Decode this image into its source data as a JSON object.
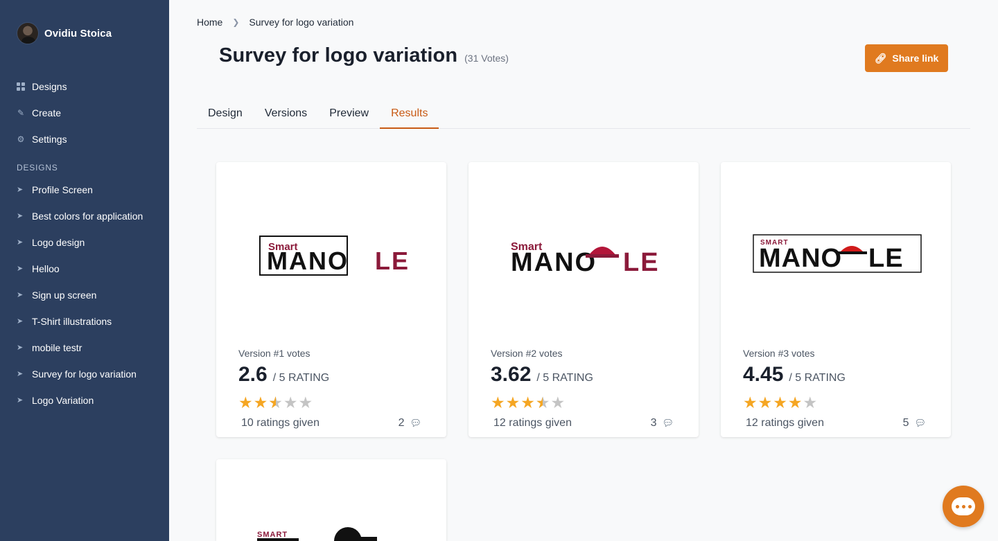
{
  "user": {
    "name": "Ovidiu Stoica"
  },
  "nav": [
    {
      "label": "Designs",
      "icon": "grid-icon"
    },
    {
      "label": "Create",
      "icon": "edit-icon"
    },
    {
      "label": "Settings",
      "icon": "gear-icon"
    }
  ],
  "sidebar_section": "DESIGNS",
  "designs": [
    "Profile Screen",
    "Best colors for application",
    "Logo design",
    "Helloo",
    "Sign up screen",
    "T-Shirt illustrations",
    "mobile testr",
    "Survey for logo variation",
    "Logo Variation"
  ],
  "breadcrumb": {
    "home": "Home",
    "current": "Survey for logo variation"
  },
  "page": {
    "title": "Survey for logo variation",
    "votes": "(31 Votes)"
  },
  "share": {
    "label": "Share link"
  },
  "tabs": [
    "Design",
    "Versions",
    "Preview",
    "Results"
  ],
  "active_tab": "Results",
  "cards": [
    {
      "version": "Version #1 votes",
      "rating": "2.6",
      "suffix": "/ 5 RATING",
      "rating_value": 2.6,
      "ratings_given": "10 ratings given",
      "comments": "2",
      "logo": {
        "smart": "Smart",
        "mano": "MANO",
        "le": "LE"
      }
    },
    {
      "version": "Version #2 votes",
      "rating": "3.62",
      "suffix": "/ 5 RATING",
      "rating_value": 3.62,
      "ratings_given": "12 ratings given",
      "comments": "3",
      "logo": {
        "smart": "Smart",
        "mano": "MANO",
        "le": "LE"
      }
    },
    {
      "version": "Version #3 votes",
      "rating": "4.45",
      "suffix": "/ 5 RATING",
      "rating_value": 4.45,
      "ratings_given": "12 ratings given",
      "comments": "5",
      "logo": {
        "smart": "SMART",
        "mano": "MANO",
        "le": "LE"
      }
    },
    {
      "logo": {
        "smart": "SMART"
      }
    }
  ],
  "colors": {
    "sidebar": "#2c3f5f",
    "accent": "#e07a1f",
    "active_tab": "#c85a14",
    "star": "#f5a623",
    "logo_red": "#8b1a3a"
  }
}
